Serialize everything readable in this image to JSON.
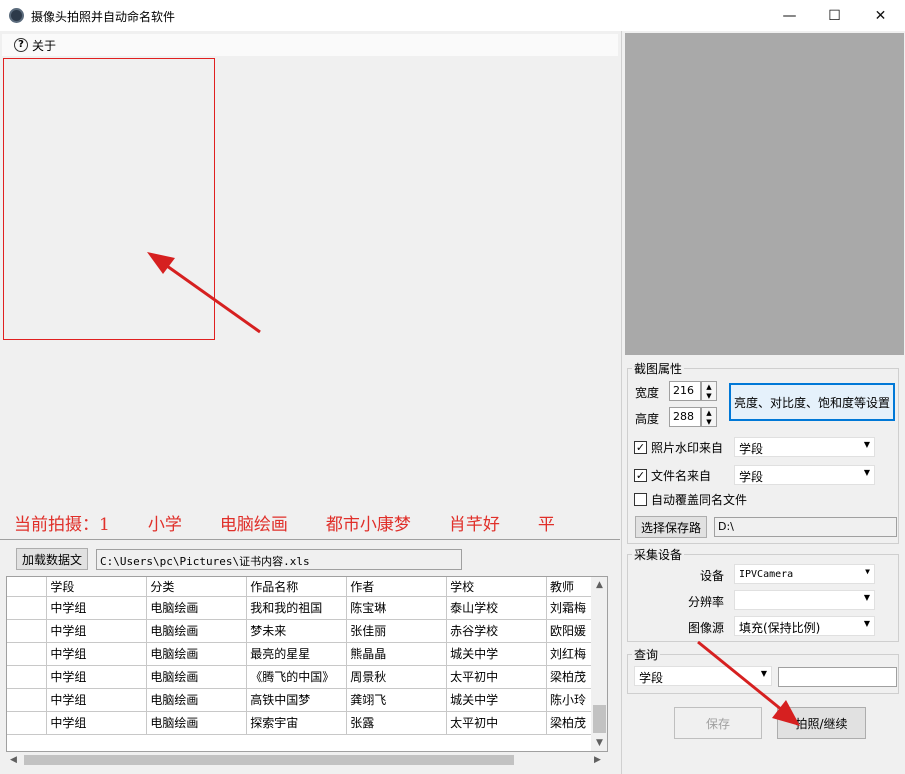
{
  "window": {
    "title": "摄像头拍照并自动命名软件",
    "minimize": "—",
    "maximize": "☐",
    "close": "✕"
  },
  "menu": {
    "about": "关于",
    "help_glyph": "?"
  },
  "status": {
    "segments": [
      "当前拍摄：1",
      "小学",
      "电脑绘画",
      "都市小康梦",
      "肖芊好",
      "平"
    ]
  },
  "data_source": {
    "load_button": "加载数据文",
    "path": "C:\\Users\\pc\\Pictures\\证书内容.xls"
  },
  "grid": {
    "columns": [
      "学段",
      "分类",
      "作品名称",
      "作者",
      "学校",
      "教师"
    ],
    "rows": [
      [
        "中学组",
        "电脑绘画",
        "我和我的祖国",
        "陈宝琳",
        "泰山学校",
        "刘霜梅"
      ],
      [
        "中学组",
        "电脑绘画",
        "梦未来",
        "张佳丽",
        "赤谷学校",
        "欧阳媛"
      ],
      [
        "中学组",
        "电脑绘画",
        "最亮的星星",
        "熊晶晶",
        "城关中学",
        "刘红梅"
      ],
      [
        "中学组",
        "电脑绘画",
        "《腾飞的中国》",
        "周景秋",
        "太平初中",
        "梁柏茂"
      ],
      [
        "中学组",
        "电脑绘画",
        "高铁中国梦",
        "龚翊飞",
        "城关中学",
        "陈小玲"
      ],
      [
        "中学组",
        "电脑绘画",
        "探索宇宙",
        "张露",
        "太平初中",
        "梁柏茂"
      ]
    ]
  },
  "capture_props": {
    "group_label": "截图属性",
    "width_label": "宽度",
    "width_value": "216",
    "height_label": "高度",
    "height_value": "288",
    "adjust_button": "亮度、对比度、饱和度等设置",
    "watermark_label": "照片水印来自",
    "watermark_checked": true,
    "watermark_value": "学段",
    "filename_label": "文件名来自",
    "filename_checked": true,
    "filename_value": "学段",
    "overwrite_label": "自动覆盖同名文件",
    "overwrite_checked": false,
    "choose_path_button": "选择保存路",
    "save_path": "D:\\"
  },
  "device": {
    "group_label": "采集设备",
    "device_label": "设备",
    "device_value": "IPVCamera",
    "resolution_label": "分辨率",
    "resolution_value": "",
    "image_source_label": "图像源",
    "image_source_value": "填充(保持比例)"
  },
  "query": {
    "group_label": "查询",
    "field_value": "学段",
    "text_value": ""
  },
  "actions": {
    "save_button": "保存",
    "capture_button": "拍照/继续"
  },
  "colors": {
    "accent_red": "#d62020",
    "status_text": "#e0302a",
    "preview_gray": "#a9a9a9",
    "focus_blue": "#0078d7"
  }
}
